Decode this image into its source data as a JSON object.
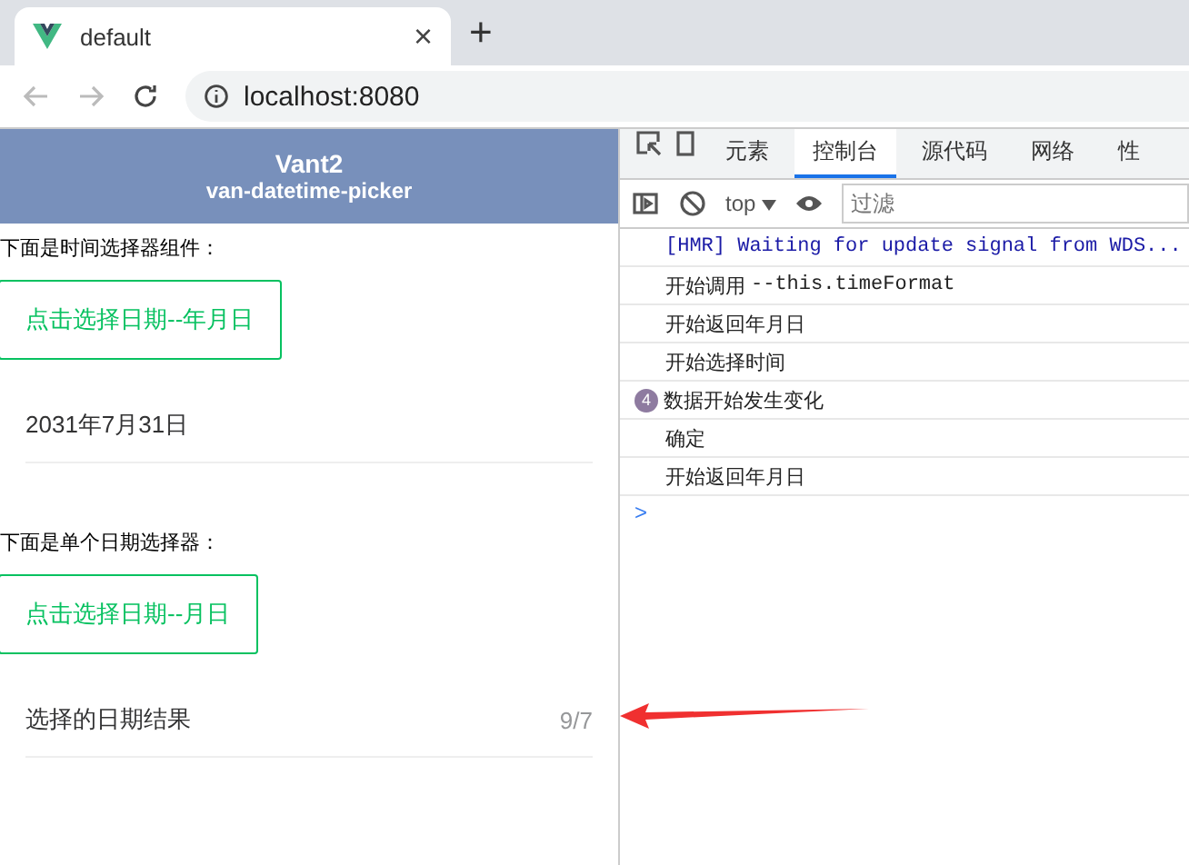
{
  "browser": {
    "tab": {
      "title": "default",
      "close": "×"
    },
    "new_tab": "+",
    "address": "localhost:8080"
  },
  "page": {
    "header": {
      "title": "Vant2",
      "subtitle": "van-datetime-picker"
    },
    "sections": [
      {
        "label": "下面是时间选择器组件：",
        "button": "点击选择日期--年月日",
        "cell": {
          "title": "2031年7月31日"
        }
      },
      {
        "label": "下面是单个日期选择器：",
        "button": "点击选择日期--月日",
        "cell": {
          "title": "选择的日期结果",
          "value": "9/7"
        }
      }
    ]
  },
  "devtools": {
    "tabs": [
      {
        "label": "元素",
        "selected": false
      },
      {
        "label": "控制台",
        "selected": true
      },
      {
        "label": "源代码",
        "selected": false
      },
      {
        "label": "网络",
        "selected": false
      },
      {
        "label": "性",
        "selected": false
      }
    ],
    "context": "top",
    "filter": {
      "placeholder": "过滤"
    },
    "console": [
      {
        "kind": "code",
        "text": "[HMR] Waiting for update signal from WDS..."
      },
      {
        "kind": "mixed",
        "text": "开始调用",
        "code": "--this.timeFormat"
      },
      {
        "kind": "plain",
        "text": "开始返回年月日"
      },
      {
        "kind": "plain",
        "text": "开始选择时间"
      },
      {
        "kind": "plain",
        "text": "数据开始发生变化",
        "count": "4"
      },
      {
        "kind": "plain",
        "text": "确定"
      },
      {
        "kind": "plain",
        "text": "开始返回年月日"
      }
    ],
    "prompt": ">"
  }
}
